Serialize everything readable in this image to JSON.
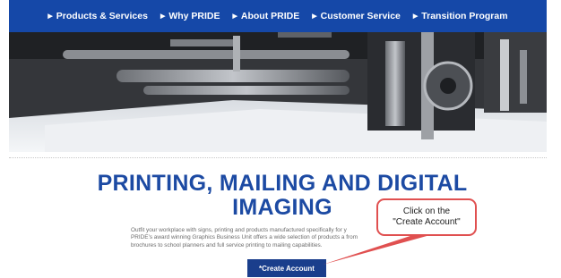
{
  "nav": {
    "items": [
      {
        "label": "Products & Services"
      },
      {
        "label": "Why PRIDE"
      },
      {
        "label": "About PRIDE"
      },
      {
        "label": "Customer Service"
      },
      {
        "label": "Transition Program"
      }
    ]
  },
  "hero": {
    "description": "printing press machinery photo"
  },
  "headline": {
    "line1": "PRINTING, MAILING AND DIGITAL",
    "line2": "IMAGING"
  },
  "body": {
    "line1": "Outfit your workplace with signs, printing and products manufactured specifically for y",
    "line2": "PRIDE’s award winning Graphics Business Unit offers a wide selection of products a               from",
    "line3": "brochures to school planners and full service printing to mailing capabilities."
  },
  "cta": {
    "label": "*Create Account"
  },
  "callout": {
    "line1": "Click on the",
    "line2": "\"Create Account\""
  },
  "colors": {
    "nav": "#1548a8",
    "headline": "#1c4aa3",
    "button": "#1a3e8c",
    "callout_border": "#e05050"
  }
}
